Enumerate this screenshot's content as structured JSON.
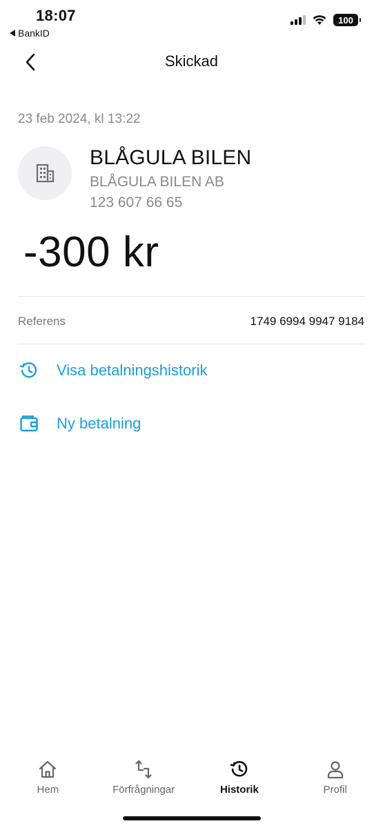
{
  "status_bar": {
    "time": "18:07",
    "back_app": "BankID",
    "battery": "100"
  },
  "header": {
    "title": "Skickad",
    "back_icon": "chevron-left-icon"
  },
  "payment": {
    "date": "23 feb 2024, kl 13:22",
    "merchant_name": "BLÅGULA BILEN",
    "merchant_company": "BLÅGULA BILEN AB",
    "merchant_number": "123 607 66 65",
    "amount": "-300 kr",
    "avatar_icon": "building-icon"
  },
  "reference": {
    "label": "Referens",
    "value": "1749 6994 9947 9184"
  },
  "actions": [
    {
      "label": "Visa betalningshistorik",
      "icon": "history-icon"
    },
    {
      "label": "Ny betalning",
      "icon": "wallet-icon"
    }
  ],
  "tabs": [
    {
      "label": "Hem",
      "icon": "home-icon",
      "active": false
    },
    {
      "label": "Förfrågningar",
      "icon": "requests-icon",
      "active": false
    },
    {
      "label": "Historik",
      "icon": "history-icon",
      "active": true
    },
    {
      "label": "Profil",
      "icon": "person-icon",
      "active": false
    }
  ],
  "colors": {
    "accent": "#1a9fd8",
    "muted_text": "#8a8a8a",
    "avatar_bg": "#f0f0f2"
  }
}
